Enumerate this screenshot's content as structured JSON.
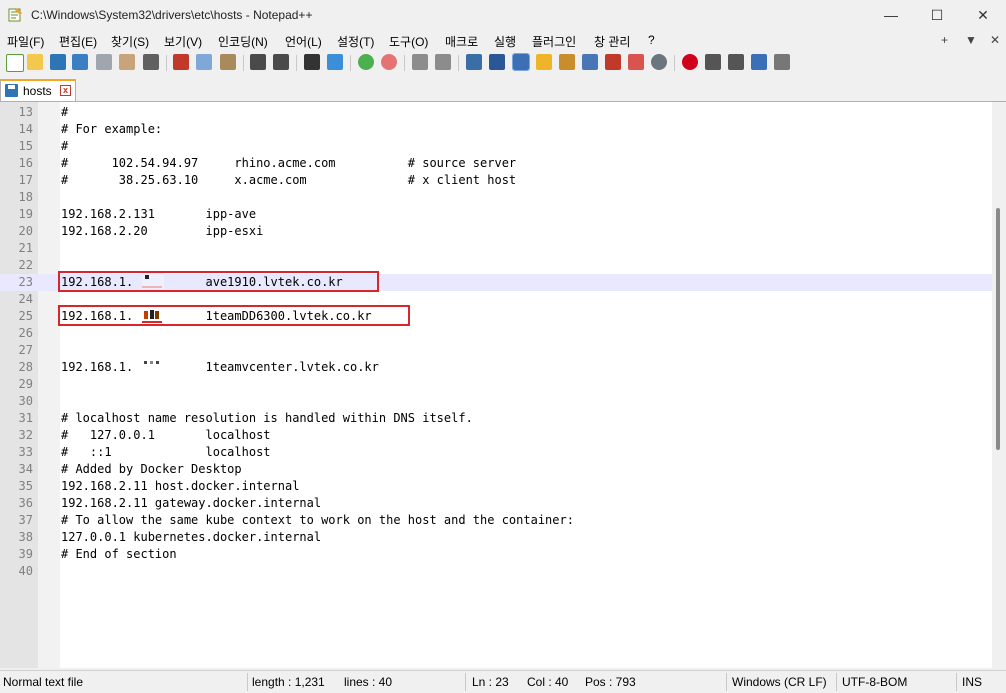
{
  "window": {
    "title": "C:\\Windows\\System32\\drivers\\etc\\hosts - Notepad++",
    "minimize_glyph": "—",
    "maximize_glyph": "☐",
    "close_glyph": "✕"
  },
  "menu": {
    "items": [
      "파일(F)",
      "편집(E)",
      "찾기(S)",
      "보기(V)",
      "인코딩(N)",
      "언어(L)",
      "설정(T)",
      "도구(O)",
      "매크로",
      "실행",
      "플러그인",
      "창 관리",
      "?"
    ],
    "right": [
      "+",
      "▼",
      "✕"
    ]
  },
  "tab": {
    "label": "hosts",
    "close_glyph": "x"
  },
  "editor": {
    "current_line": "23",
    "lines": [
      {
        "n": "13",
        "t": "#"
      },
      {
        "n": "14",
        "t": "# For example:"
      },
      {
        "n": "15",
        "t": "#"
      },
      {
        "n": "16",
        "t": "#      102.54.94.97     rhino.acme.com          # source server"
      },
      {
        "n": "17",
        "t": "#       38.25.63.10     x.acme.com              # x client host"
      },
      {
        "n": "18",
        "t": ""
      },
      {
        "n": "19",
        "t": "192.168.2.131       ipp-ave"
      },
      {
        "n": "20",
        "t": "192.168.2.20        ipp-esxi"
      },
      {
        "n": "21",
        "t": ""
      },
      {
        "n": "22",
        "t": ""
      },
      {
        "n": "23",
        "t": "192.168.1.          ave1910.lvtek.co.kr"
      },
      {
        "n": "24",
        "t": ""
      },
      {
        "n": "25",
        "t": "192.168.1.          1teamDD6300.lvtek.co.kr"
      },
      {
        "n": "26",
        "t": ""
      },
      {
        "n": "27",
        "t": ""
      },
      {
        "n": "28",
        "t": "192.168.1.          1teamvcenter.lvtek.co.kr"
      },
      {
        "n": "29",
        "t": ""
      },
      {
        "n": "30",
        "t": ""
      },
      {
        "n": "31",
        "t": "# localhost name resolution is handled within DNS itself."
      },
      {
        "n": "32",
        "t": "#   127.0.0.1       localhost"
      },
      {
        "n": "33",
        "t": "#   ::1             localhost"
      },
      {
        "n": "34",
        "t": "# Added by Docker Desktop"
      },
      {
        "n": "35",
        "t": "192.168.2.11 host.docker.internal"
      },
      {
        "n": "36",
        "t": "192.168.2.11 gateway.docker.internal"
      },
      {
        "n": "37",
        "t": "# To allow the same kube context to work on the host and the container:"
      },
      {
        "n": "38",
        "t": "127.0.0.1 kubernetes.docker.internal"
      },
      {
        "n": "39",
        "t": "# End of section"
      },
      {
        "n": "40",
        "t": ""
      }
    ]
  },
  "status": {
    "file_type": "Normal text file",
    "length": "length : 1,231",
    "lines": "lines : 40",
    "ln": "Ln : 23",
    "col": "Col : 40",
    "pos": "Pos : 793",
    "eol": "Windows (CR LF)",
    "encoding": "UTF-8-BOM",
    "mode": "INS"
  },
  "colors": {
    "highlight_box": "#d9262c",
    "current_line_bg": "#e8e8ff",
    "tab_accent": "#f5a623"
  }
}
